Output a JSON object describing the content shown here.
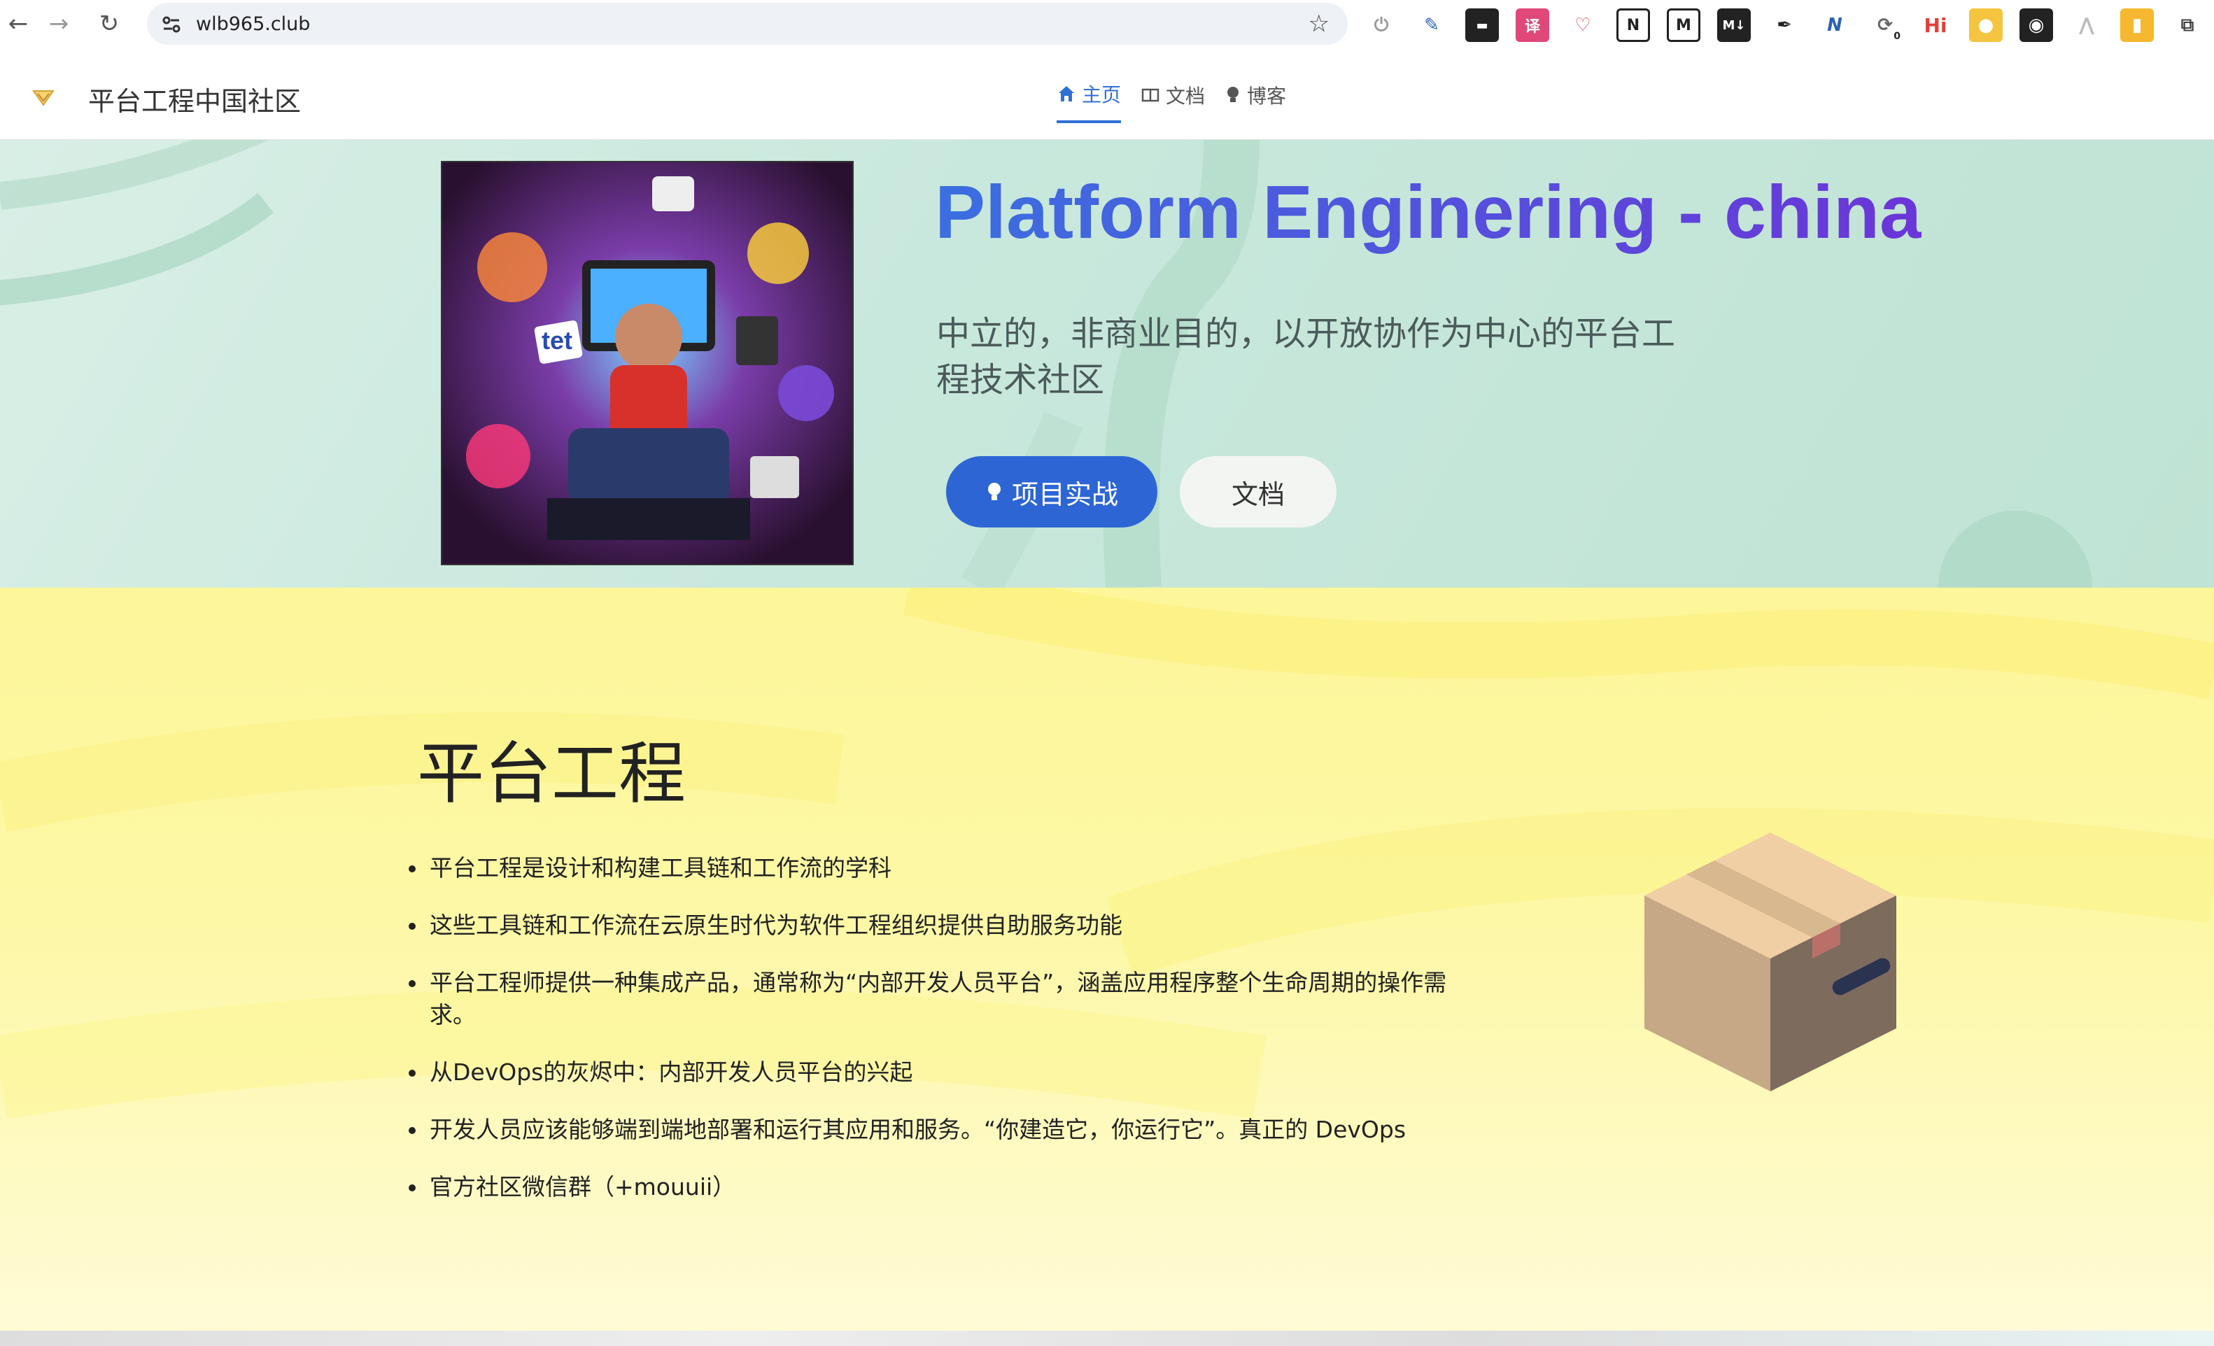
{
  "browser": {
    "url": "wlb965.club",
    "extensions": [
      "power-icon",
      "highlighter-icon",
      "terminal-icon",
      "translate-icon",
      "pocket-icon",
      "notion-icon",
      "medium-icon",
      "markdown-icon",
      "eyedropper-icon",
      "n-icon",
      "sync-icon",
      "hi-icon",
      "yellow-app-icon",
      "dark-app-icon",
      "a-icon",
      "yellow-tag-icon",
      "puzzle-icon"
    ],
    "sync_badge": "0",
    "hi_label": "Hi"
  },
  "header": {
    "site_title": "平台工程中国社区",
    "nav": [
      {
        "label": "主页",
        "icon": "home-icon",
        "active": true
      },
      {
        "label": "文档",
        "icon": "book-icon",
        "active": false
      },
      {
        "label": "博客",
        "icon": "bulb-icon",
        "active": false
      }
    ]
  },
  "hero": {
    "title": "Platform Enginering - china",
    "subtitle": "中立的，非商业目的，以开放协作为中心的平台工程技术社区",
    "primary_button": "项目实战",
    "secondary_button": "文档",
    "image_caption": "tet"
  },
  "feature": {
    "title": "平台工程",
    "items": [
      "平台工程是设计和构建工具链和工作流的学科",
      "这些工具链和工作流在云原生时代为软件工程组织提供自助服务功能",
      "平台工程师提供一种集成产品，通常称为“内部开发人员平台”，涵盖应用程序整个生命周期的操作需求。",
      "从DevOps的灰烬中：内部开发人员平台的兴起",
      "开发人员应该能够端到端地部署和运行其应用和服务。“你建造它，你运行它”。真正的 DevOps",
      "官方社区微信群（+mouuii）"
    ]
  },
  "colors": {
    "accent": "#2d66d4",
    "title_gradient_start": "#3b6fe0",
    "title_gradient_end": "#6b35d8",
    "hero_bg": "#c9e8dd",
    "feature_bg": "#fdf69a"
  }
}
